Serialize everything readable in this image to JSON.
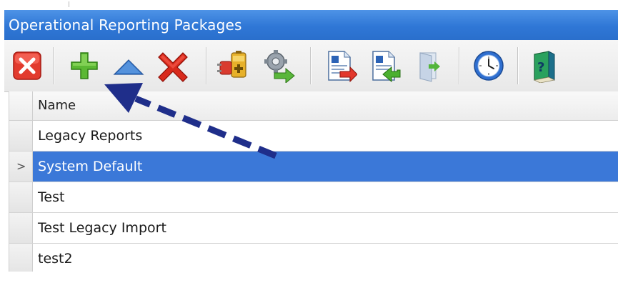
{
  "window": {
    "title": "Operational Reporting Packages"
  },
  "toolbar": {
    "buttons": [
      {
        "icon": "close-red-square-icon"
      },
      {
        "icon": "add-plus-icon"
      },
      {
        "icon": "move-up-triangle-icon"
      },
      {
        "icon": "delete-x-icon"
      },
      {
        "icon": "plugin-battery-icon"
      },
      {
        "icon": "gear-arrow-icon"
      },
      {
        "icon": "export-report-icon"
      },
      {
        "icon": "import-report-icon"
      },
      {
        "icon": "exit-door-icon"
      },
      {
        "icon": "clock-icon"
      },
      {
        "icon": "help-book-icon"
      }
    ]
  },
  "grid": {
    "header": {
      "name": "Name"
    },
    "rows": [
      {
        "name": "Legacy Reports",
        "selected": false
      },
      {
        "name": "System Default",
        "selected": true,
        "indicator": ">"
      },
      {
        "name": "Test",
        "selected": false
      },
      {
        "name": "Test Legacy Import",
        "selected": false
      },
      {
        "name": "test2",
        "selected": false
      }
    ]
  },
  "colors": {
    "titlebar": "#2f77d6",
    "selection": "#3b78d8",
    "annotation_arrow": "#1f2e8a"
  }
}
